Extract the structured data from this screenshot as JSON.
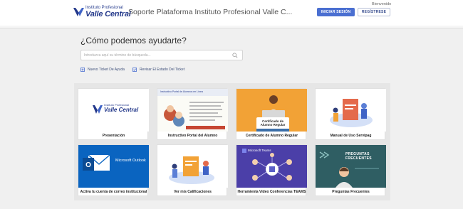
{
  "header": {
    "logo_small": "Instituto Profesional",
    "logo_big": "Valle Central",
    "site_title": "Soporte Plataforma Instituto Profesional Valle C...",
    "welcome": "Bienvenido",
    "login_label": "INICIAR SESIÓN",
    "register_label": "REGÍSTRESE"
  },
  "main": {
    "help_title": "¿Cómo podemos ayudarte?",
    "search_placeholder": "Introduzca aquí su término de búsqueda...",
    "new_ticket_label": "Nuevo Ticket De Ayuda",
    "check_ticket_label": "Revisar El Estado Del Ticket"
  },
  "cards": [
    {
      "label": "Presentación",
      "thumb_text": "Instituto Profesional Valle Central"
    },
    {
      "label": "Instructivo Portal del Alumno",
      "thumb_text": "Instructivo Portal de Alumnos en Línea"
    },
    {
      "label": "Certificado de Alumno Regular",
      "thumb_text": "Certificado de Alumno Regular"
    },
    {
      "label": "Manual de Uso Servipag",
      "thumb_text": ""
    },
    {
      "label": "Activa tu cuenta de correo institucional",
      "thumb_text": "Microsoft Outlook"
    },
    {
      "label": "Ver mis Calificaciones",
      "thumb_text": ""
    },
    {
      "label": "Herramienta Video Conferencias TEAMS",
      "thumb_text": "Microsoft Teams"
    },
    {
      "label": "Preguntas Frecuentes",
      "thumb_text": "PREGUNTAS FRECUENTES"
    }
  ],
  "colors": {
    "brand": "#23388a",
    "primary_button": "#4a6fd1",
    "outlook_blue": "#0a64c0",
    "teams_purple": "#4b3fa8",
    "faq_teal": "#2f5e63",
    "certificate_orange": "#f2a236"
  }
}
